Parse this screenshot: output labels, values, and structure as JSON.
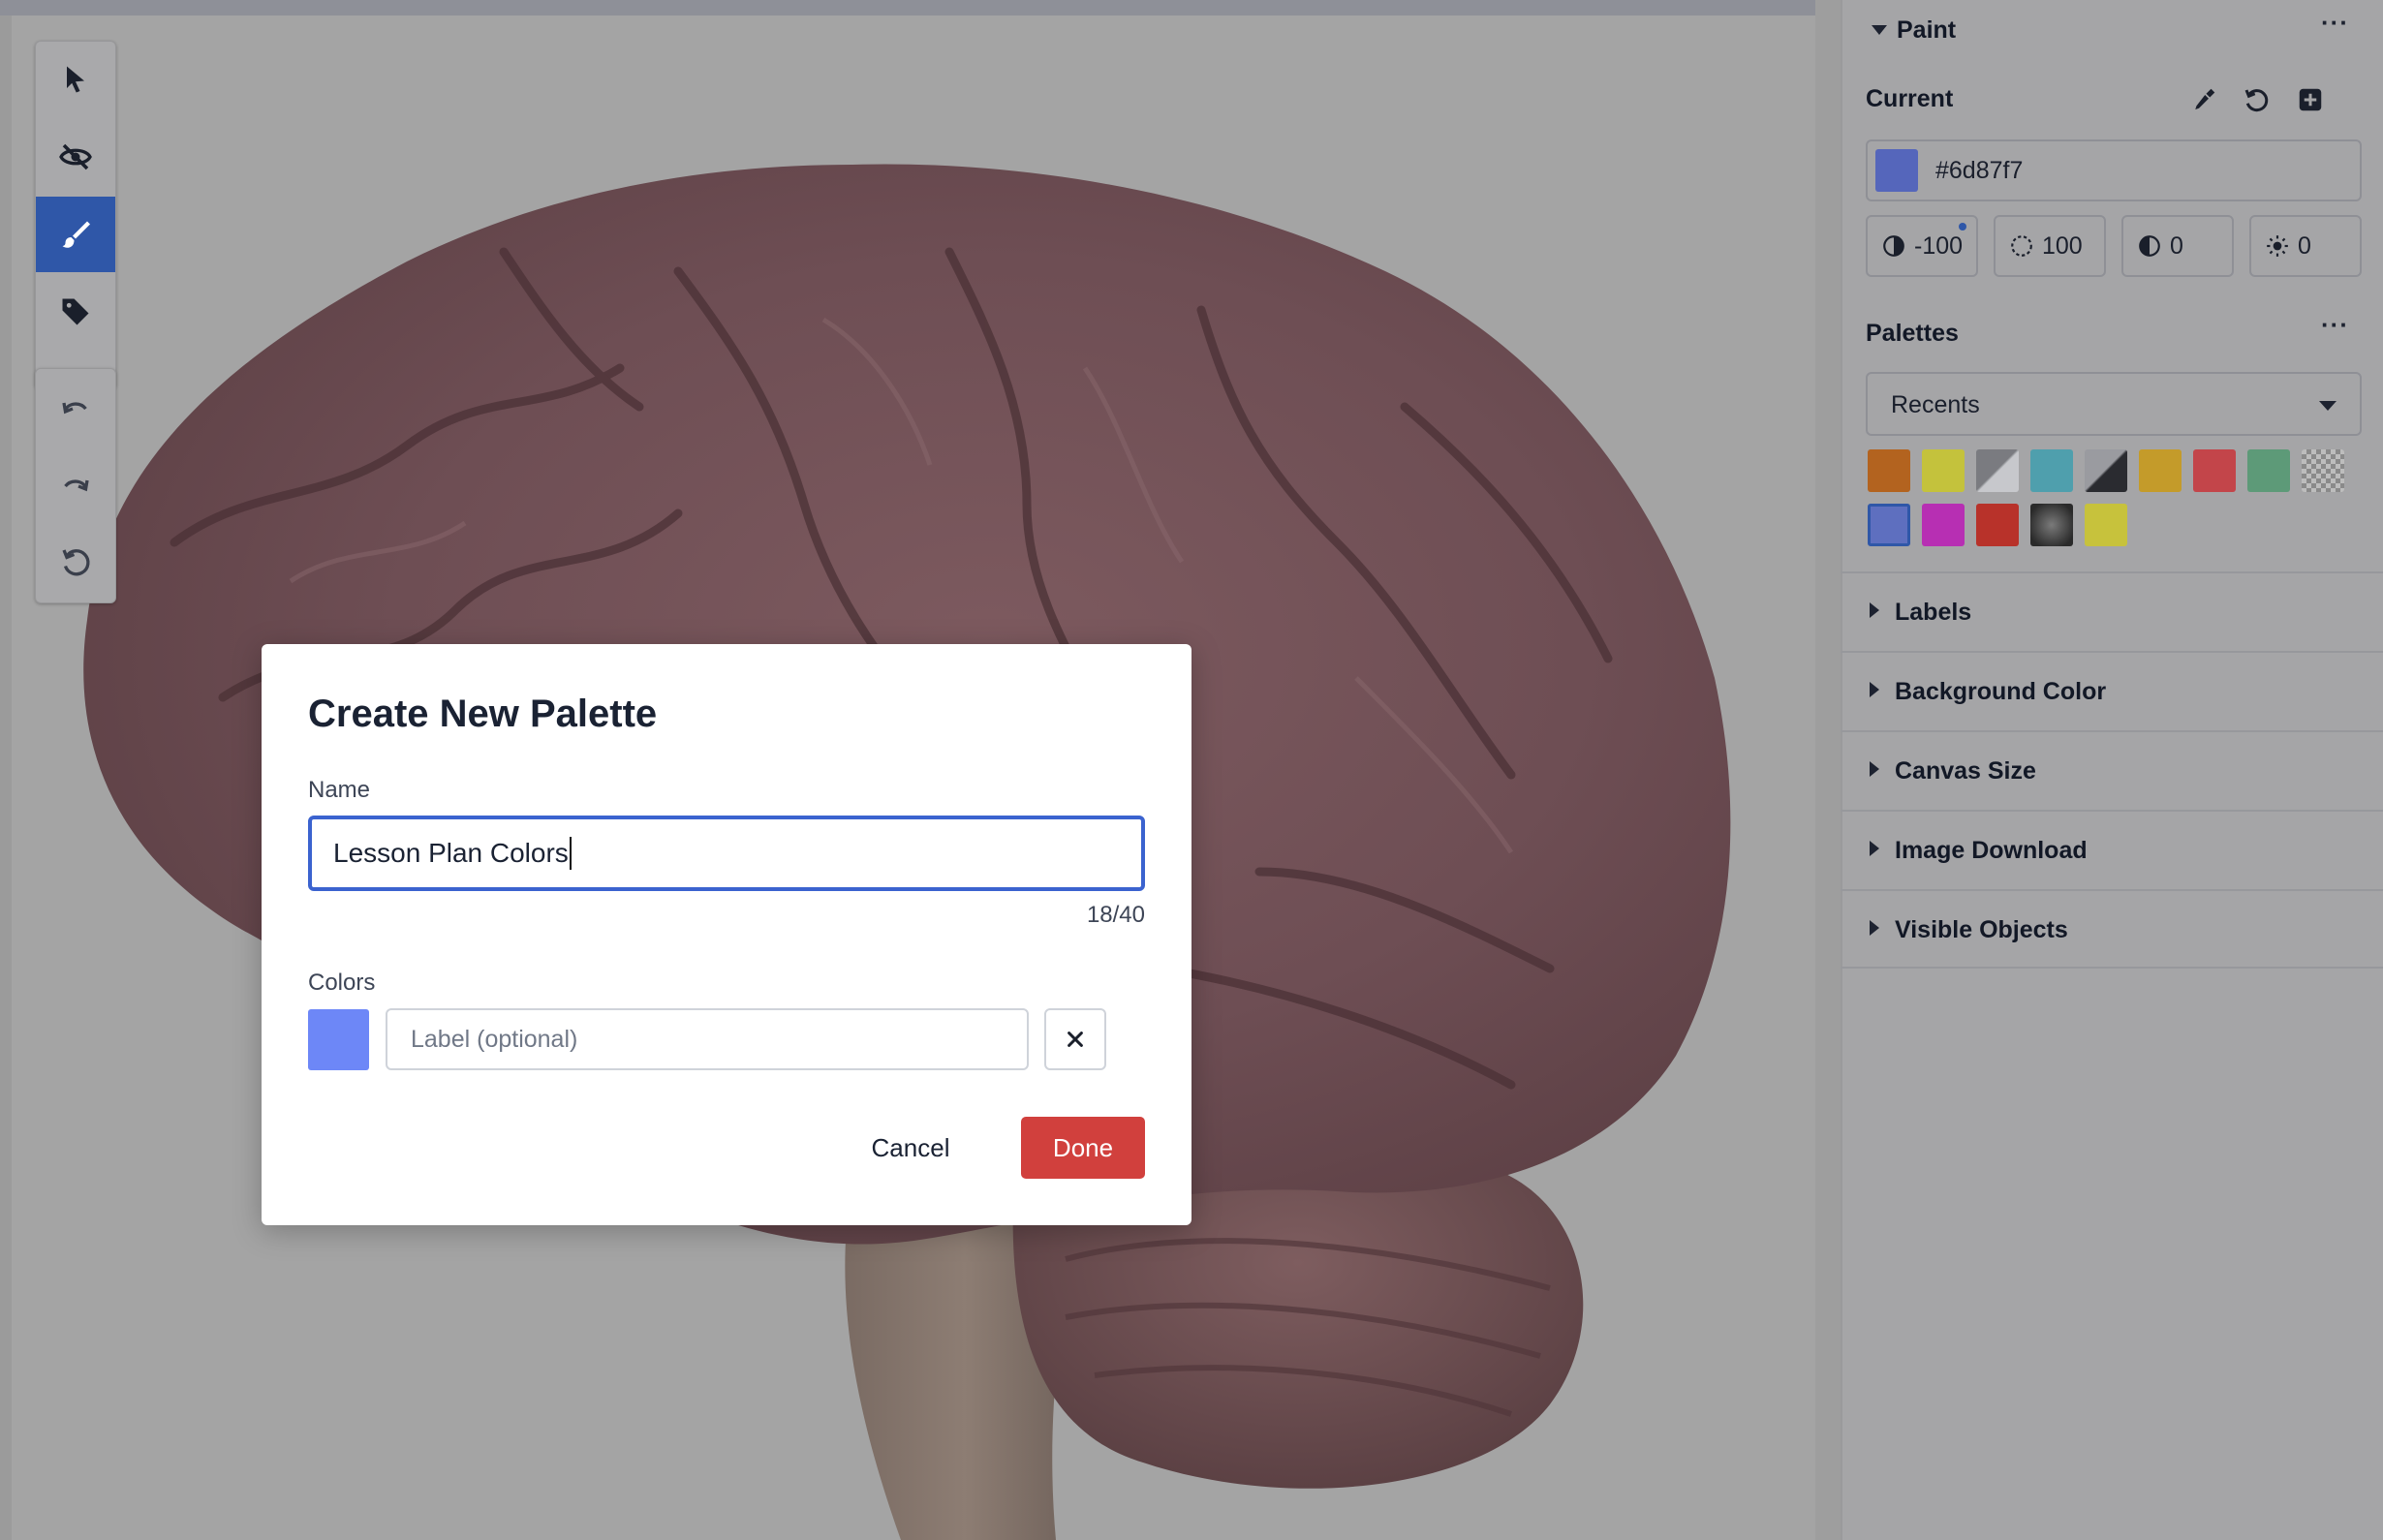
{
  "paint": {
    "title": "Paint",
    "current_label": "Current",
    "current_color": "#6d87f7",
    "hex_value": "#6d87f7",
    "adjustments": [
      {
        "icon": "contrast-icon",
        "value": "-100"
      },
      {
        "icon": "opacity-icon",
        "value": "100"
      },
      {
        "icon": "shade-icon",
        "value": "0"
      },
      {
        "icon": "brightness-icon",
        "value": "0"
      }
    ],
    "palettes_label": "Palettes",
    "palette_select": "Recents",
    "swatches": [
      "#b3631f",
      "#c4c23c",
      "gradient-gray",
      "#4f9fad",
      "gradient-dark",
      "#c49b2a",
      "#c3454a",
      "#5d9a78",
      "checker",
      "#5e6fbf",
      "#b72fb3",
      "#b8322a",
      "radial-dark",
      "#c7c23c"
    ]
  },
  "sections": [
    "Labels",
    "Background Color",
    "Canvas Size",
    "Image Download",
    "Visible Objects"
  ],
  "toolbar": {
    "tools": [
      "select-tool",
      "hide-tool",
      "paint-tool",
      "label-tool"
    ],
    "history": [
      "undo",
      "redo",
      "reset"
    ],
    "active_tool": "paint-tool"
  },
  "modal": {
    "title": "Create New Palette",
    "name_label": "Name",
    "name_value": "Lesson Plan Colors",
    "char_count": "18/40",
    "colors_label": "Colors",
    "color_swatch": "#6d87f7",
    "label_placeholder": "Label (optional)",
    "cancel": "Cancel",
    "done": "Done"
  }
}
